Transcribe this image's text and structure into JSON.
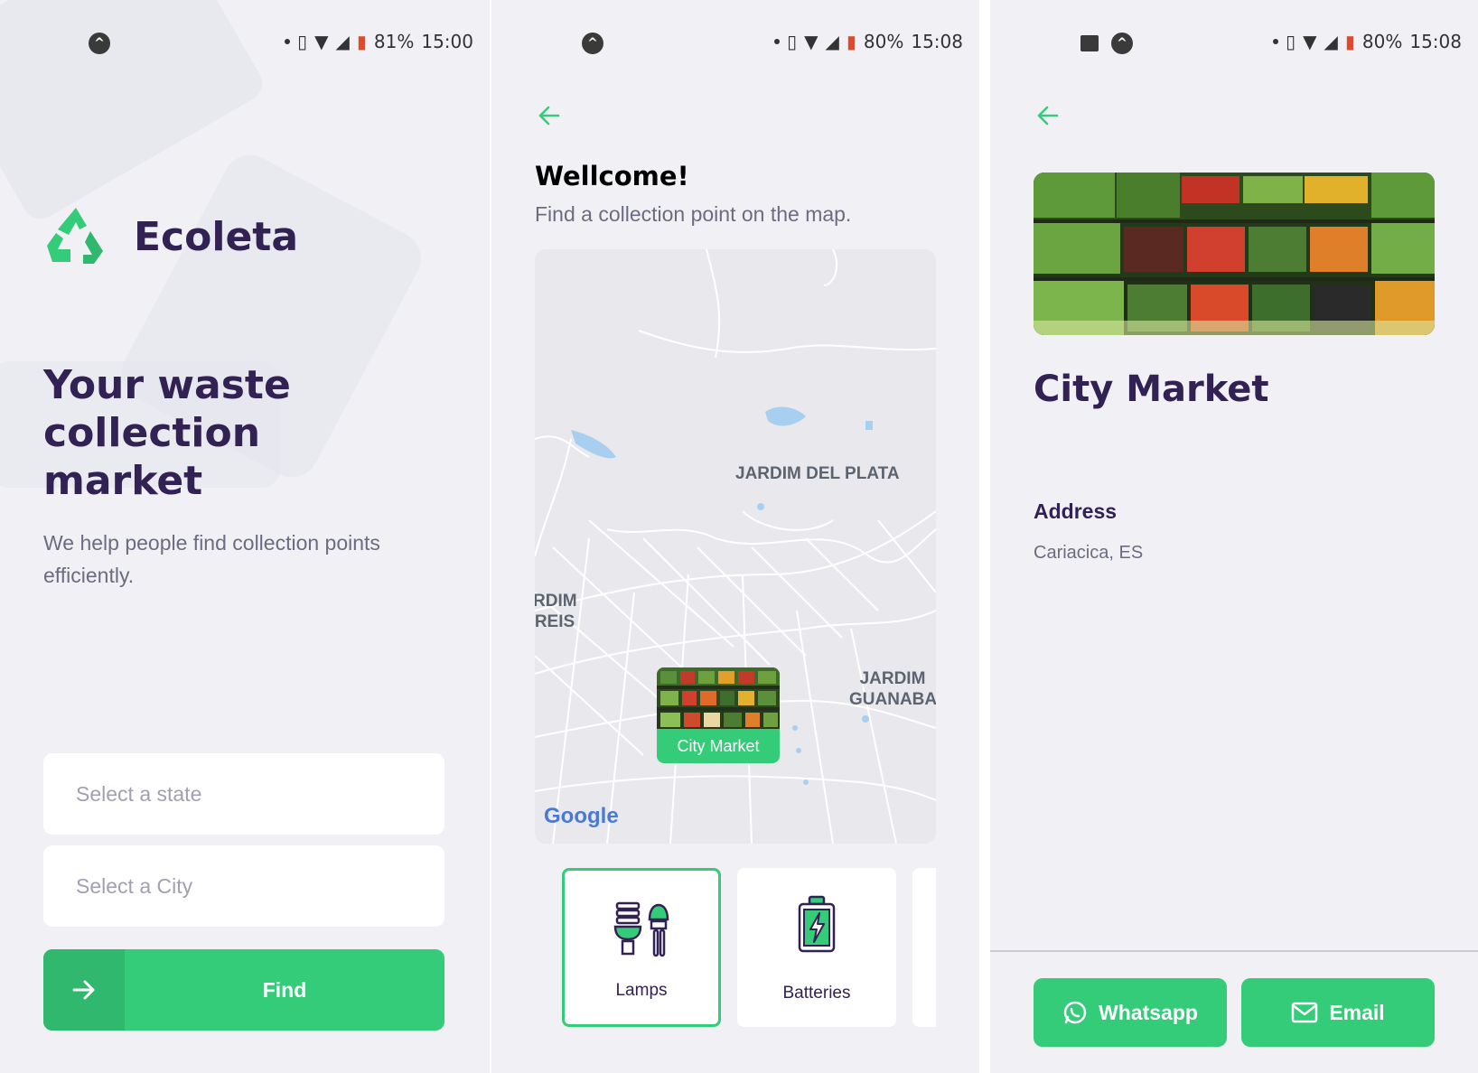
{
  "colors": {
    "primary": "#34cb79",
    "primary_dark": "#2fb86e",
    "title": "#322153",
    "text": "#6c6c80",
    "background": "#f0f0f5",
    "placeholder": "#a0a0b2"
  },
  "screen1": {
    "status": {
      "battery": "81%",
      "time": "15:00"
    },
    "brand": "Ecoleta",
    "hero_title": "Your waste collection market",
    "hero_desc": "We help people find collection points efficiently.",
    "state_placeholder": "Select a state",
    "city_placeholder": "Select a City",
    "find_label": "Find",
    "icons": [
      "recycle-icon",
      "arrow-right-icon"
    ]
  },
  "screen2": {
    "status": {
      "battery": "80%",
      "time": "15:08"
    },
    "title": "Wellcome!",
    "description": "Find a collection point on the map.",
    "map": {
      "labels": [
        "JARDIM DEL PLATA",
        "RDIM REIS",
        "JARDIM GUANABAR"
      ],
      "marker_label": "City Market",
      "attribution": "Google"
    },
    "items": [
      {
        "label": "Lamps",
        "icon": "lamp-icon",
        "selected": true
      },
      {
        "label": "Batteries",
        "icon": "battery-icon",
        "selected": false
      }
    ]
  },
  "screen3": {
    "status": {
      "battery": "80%",
      "time": "15:08"
    },
    "name": "City Market",
    "address_heading": "Address",
    "address": "Cariacica, ES",
    "whatsapp_label": "Whatsapp",
    "email_label": "Email"
  }
}
